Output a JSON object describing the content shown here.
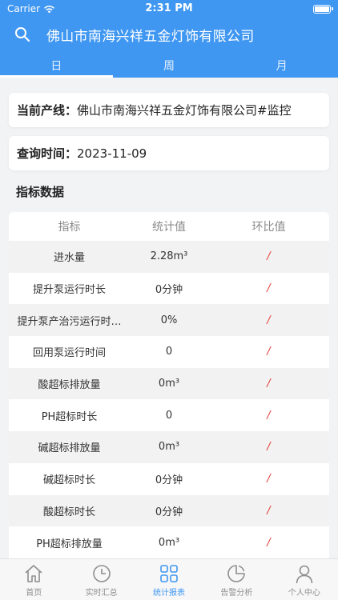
{
  "status_bar": {
    "carrier": "Carrier",
    "time": "2:31 PM"
  },
  "header": {
    "title": "佛山市南海兴祥五金灯饰有限公司"
  },
  "tabs": [
    {
      "label": "日",
      "active": true
    },
    {
      "label": "周",
      "active": false
    },
    {
      "label": "月",
      "active": false
    }
  ],
  "info": {
    "line_label": "当前产线：",
    "line_value": "佛山市南海兴祥五金灯饰有限公司#监控",
    "date_label": "查询时间：",
    "date_value": "2023-11-09"
  },
  "section_title": "指标数据",
  "table": {
    "headers": [
      "指标",
      "统计值",
      "环比值"
    ],
    "rows": [
      {
        "name": "进水量",
        "value": "2.28m³",
        "ratio": "/"
      },
      {
        "name": "提升泵运行时长",
        "value": "0分钟",
        "ratio": "/"
      },
      {
        "name": "提升泵产治污运行时…",
        "value": "0%",
        "ratio": "/"
      },
      {
        "name": "回用泵运行时间",
        "value": "0",
        "ratio": "/"
      },
      {
        "name": "酸超标排放量",
        "value": "0m³",
        "ratio": "/"
      },
      {
        "name": "PH超标时长",
        "value": "0",
        "ratio": "/"
      },
      {
        "name": "碱超标排放量",
        "value": "0m³",
        "ratio": "/"
      },
      {
        "name": "碱超标时长",
        "value": "0分钟",
        "ratio": "/"
      },
      {
        "name": "酸超标时长",
        "value": "0分钟",
        "ratio": "/"
      },
      {
        "name": "PH超标排放量",
        "value": "0m³",
        "ratio": "/"
      }
    ]
  },
  "tabbar": [
    {
      "label": "首页",
      "icon": "home-icon",
      "active": false
    },
    {
      "label": "实时汇总",
      "icon": "clock-icon",
      "active": false
    },
    {
      "label": "统计报表",
      "icon": "grid-icon",
      "active": true
    },
    {
      "label": "告警分析",
      "icon": "pie-chart-icon",
      "active": false
    },
    {
      "label": "个人中心",
      "icon": "user-icon",
      "active": false
    }
  ],
  "colors": {
    "primary": "#3f97f2",
    "ratio_red": "#e5403b"
  }
}
